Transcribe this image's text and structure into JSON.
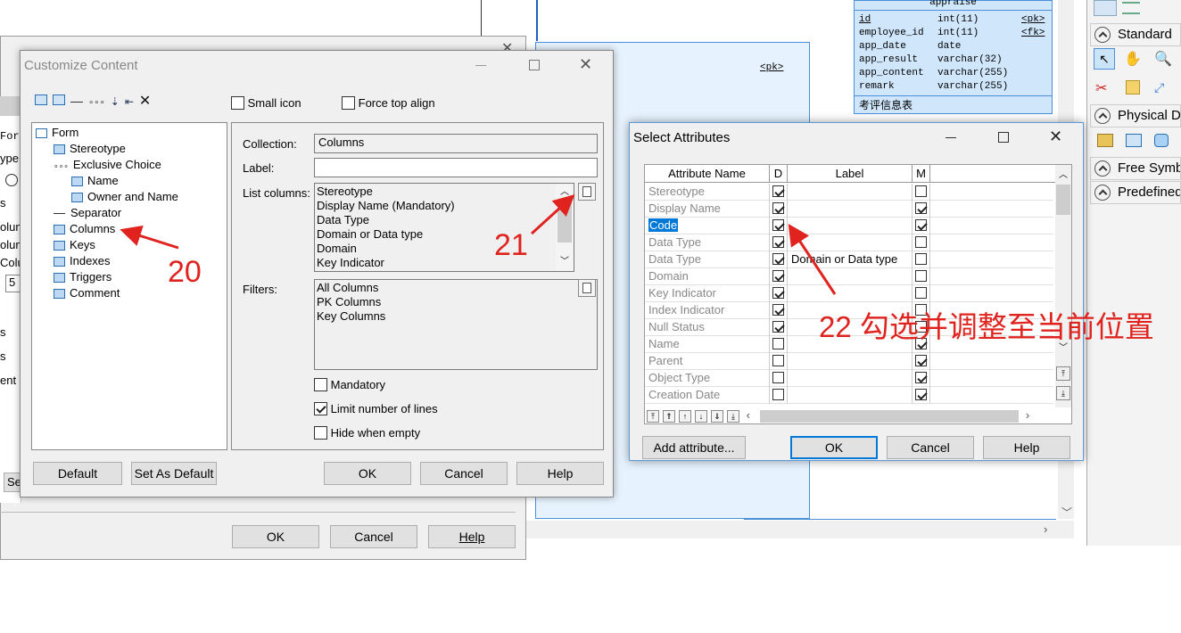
{
  "bg_table": {
    "title": "appraise",
    "rows": [
      {
        "name": "id",
        "type": "int(11)",
        "key": "<pk>"
      },
      {
        "name": "employee_id",
        "type": "int(11)",
        "key": "<fk>"
      },
      {
        "name": "app_date",
        "type": "date",
        "key": ""
      },
      {
        "name": "app_result",
        "type": "varchar(32)",
        "key": ""
      },
      {
        "name": "app_content",
        "type": "varchar(255)",
        "key": ""
      },
      {
        "name": "remark",
        "type": "varchar(255)",
        "key": ""
      }
    ],
    "comment": "考评信息表",
    "pk_label": "<pk>"
  },
  "bg_dialog": {
    "left_fragments": [
      "For",
      "ype",
      "s",
      "olum",
      "olum",
      "Colu",
      "5",
      "s",
      "s",
      "ent",
      "Se"
    ],
    "buttons": {
      "ok": "OK",
      "cancel": "Cancel",
      "help": "Help"
    }
  },
  "customize": {
    "title": "Customize Content",
    "small_icon": "Small icon",
    "force_top_align": "Force top align",
    "tree": [
      "Form",
      "Stereotype",
      "Exclusive Choice",
      "Name",
      "Owner and Name",
      "Separator",
      "Columns",
      "Keys",
      "Indexes",
      "Triggers",
      "Comment"
    ],
    "collection_label": "Collection:",
    "collection_value": "Columns",
    "label_label": "Label:",
    "label_value": "",
    "list_columns_label": "List columns:",
    "list_columns": [
      "Stereotype",
      "Display Name (Mandatory)",
      "Data Type",
      "Domain or Data type",
      "Domain",
      "Key Indicator"
    ],
    "filters_label": "Filters:",
    "filters": [
      "All Columns",
      "PK Columns",
      "Key Columns"
    ],
    "mandatory": "Mandatory",
    "limit_lines": "Limit number of lines",
    "hide_empty": "Hide when empty",
    "buttons": {
      "default": "Default",
      "set_default": "Set As Default",
      "ok": "OK",
      "cancel": "Cancel",
      "help": "Help"
    }
  },
  "select_attrs": {
    "title": "Select Attributes",
    "headers": {
      "name": "Attribute Name",
      "d": "D",
      "label": "Label",
      "m": "M"
    },
    "rows": [
      {
        "name": "Stereotype",
        "d": true,
        "label": "",
        "m": false
      },
      {
        "name": "Display Name",
        "d": true,
        "label": "",
        "m": true
      },
      {
        "name": "Code",
        "d": true,
        "label": "",
        "m": true
      },
      {
        "name": "Data Type",
        "d": true,
        "label": "",
        "m": false
      },
      {
        "name": "Data Type",
        "d": true,
        "label": "Domain or Data type",
        "m": false
      },
      {
        "name": "Domain",
        "d": true,
        "label": "",
        "m": false
      },
      {
        "name": "Key Indicator",
        "d": true,
        "label": "",
        "m": false
      },
      {
        "name": "Index Indicator",
        "d": true,
        "label": "",
        "m": false
      },
      {
        "name": "Null Status",
        "d": true,
        "label": "",
        "m": false
      },
      {
        "name": "Name",
        "d": false,
        "label": "",
        "m": true
      },
      {
        "name": "Parent",
        "d": false,
        "label": "",
        "m": true
      },
      {
        "name": "Object Type",
        "d": false,
        "label": "",
        "m": true
      },
      {
        "name": "Creation Date",
        "d": false,
        "label": "",
        "m": true
      }
    ],
    "buttons": {
      "add": "Add attribute...",
      "ok": "OK",
      "cancel": "Cancel",
      "help": "Help"
    }
  },
  "right_panel": {
    "sections": [
      "Standard",
      "Physical D",
      "Free Symb",
      "Predefined"
    ]
  },
  "annotations": {
    "a20": "20",
    "a21": "21",
    "a22": "22 勾选并调整至当前位置"
  },
  "colors": {
    "annotation": "#e0231e",
    "selection": "#0078d7",
    "table_bg": "#cfe6fb"
  }
}
